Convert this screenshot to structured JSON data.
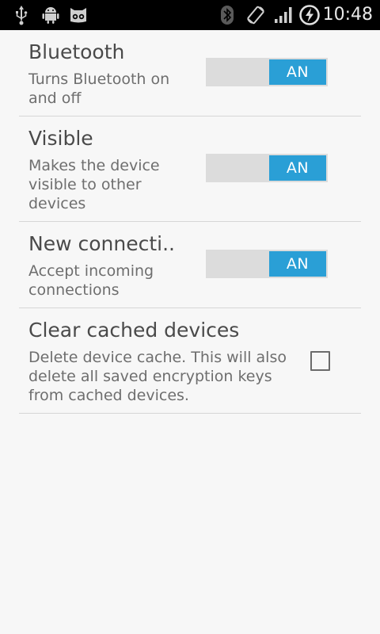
{
  "status_bar": {
    "time": "10:48",
    "left_icons": [
      "usb-icon",
      "android-debug-icon",
      "cyanogenmod-icon"
    ],
    "right_icons": [
      "bluetooth-icon",
      "rotation-icon",
      "signal-icon",
      "battery-charging-icon"
    ]
  },
  "preferences": [
    {
      "title": "Bluetooth",
      "summary": "Turns Bluetooth on\nand off",
      "control": "switch",
      "switch_label": "AN",
      "checked": true
    },
    {
      "title": "Visible",
      "summary": "Makes the device\nvisible to other\ndevices",
      "control": "switch",
      "switch_label": "AN",
      "checked": true
    },
    {
      "title": "New connecti..",
      "summary": "Accept incoming\nconnections",
      "control": "switch",
      "switch_label": "AN",
      "checked": true
    },
    {
      "title": "Clear cached devices",
      "summary": "Delete device cache. This will also\ndelete all saved encryption keys\nfrom cached devices.",
      "control": "checkbox",
      "checked": false
    }
  ],
  "colors": {
    "accent": "#2a9fd6",
    "background": "#f7f7f7",
    "status_bar": "#000000"
  }
}
